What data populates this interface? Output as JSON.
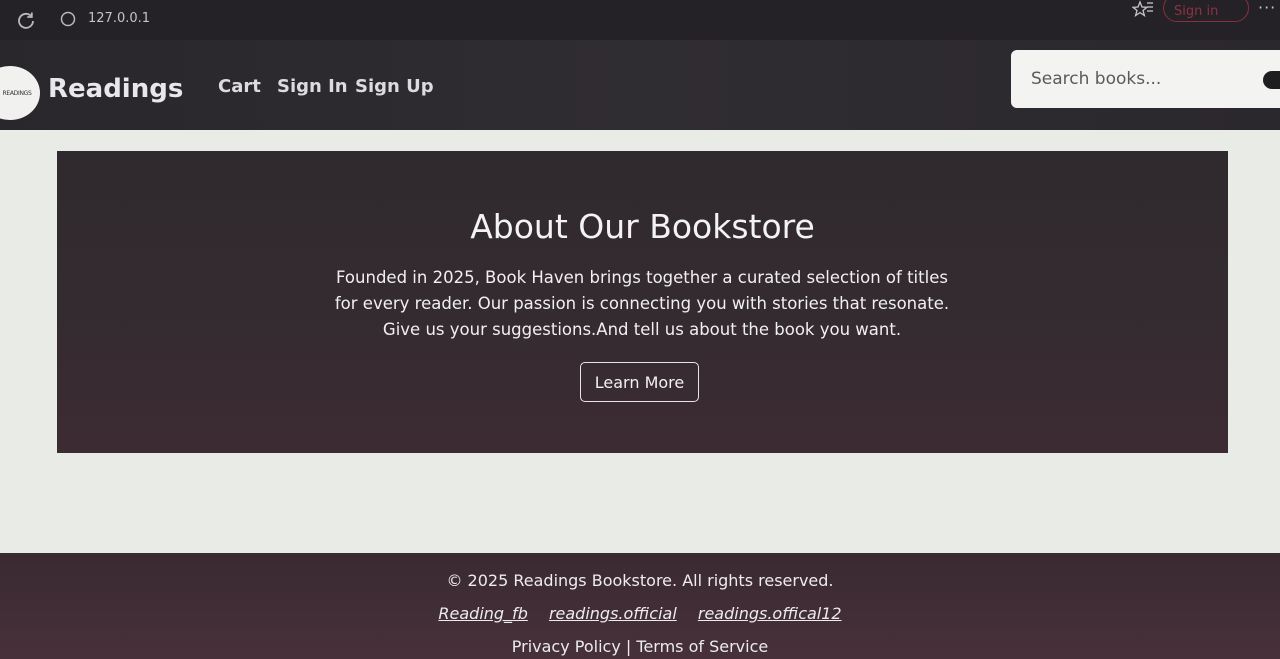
{
  "browser": {
    "url": "127.0.0.1",
    "signin_label": "Sign in",
    "more_label": "···",
    "icons": [
      "reload-icon",
      "site-info-icon",
      "favorites-icon",
      "more-icon"
    ]
  },
  "header": {
    "logo_text": "READINGS",
    "brand": "Readings",
    "nav": {
      "cart": "Cart",
      "sign_in": "Sign In",
      "sign_up": "Sign Up"
    },
    "search_placeholder": "Search books..."
  },
  "about": {
    "title": "About Our Bookstore",
    "line1": "Founded in 2025, Book Haven brings together a curated selection of titles",
    "line2": "for every reader. Our passion is connecting you with stories that resonate.",
    "line3": "Give us your suggestions.And tell us about the book you want.",
    "button_label": "Learn More"
  },
  "footer": {
    "copyright": "© 2025 Readings Bookstore. All rights reserved.",
    "social": {
      "fb": "Reading_fb",
      "official": "readings.official",
      "official12": "readings.offical12"
    },
    "privacy": "Privacy Policy",
    "separator": "|",
    "terms": "Terms of Service"
  },
  "colors": {
    "chrome": "#242226",
    "header": "#2d2a2f",
    "banner": "#342b30",
    "footer": "#402d35",
    "page": "#e9ebe6"
  }
}
